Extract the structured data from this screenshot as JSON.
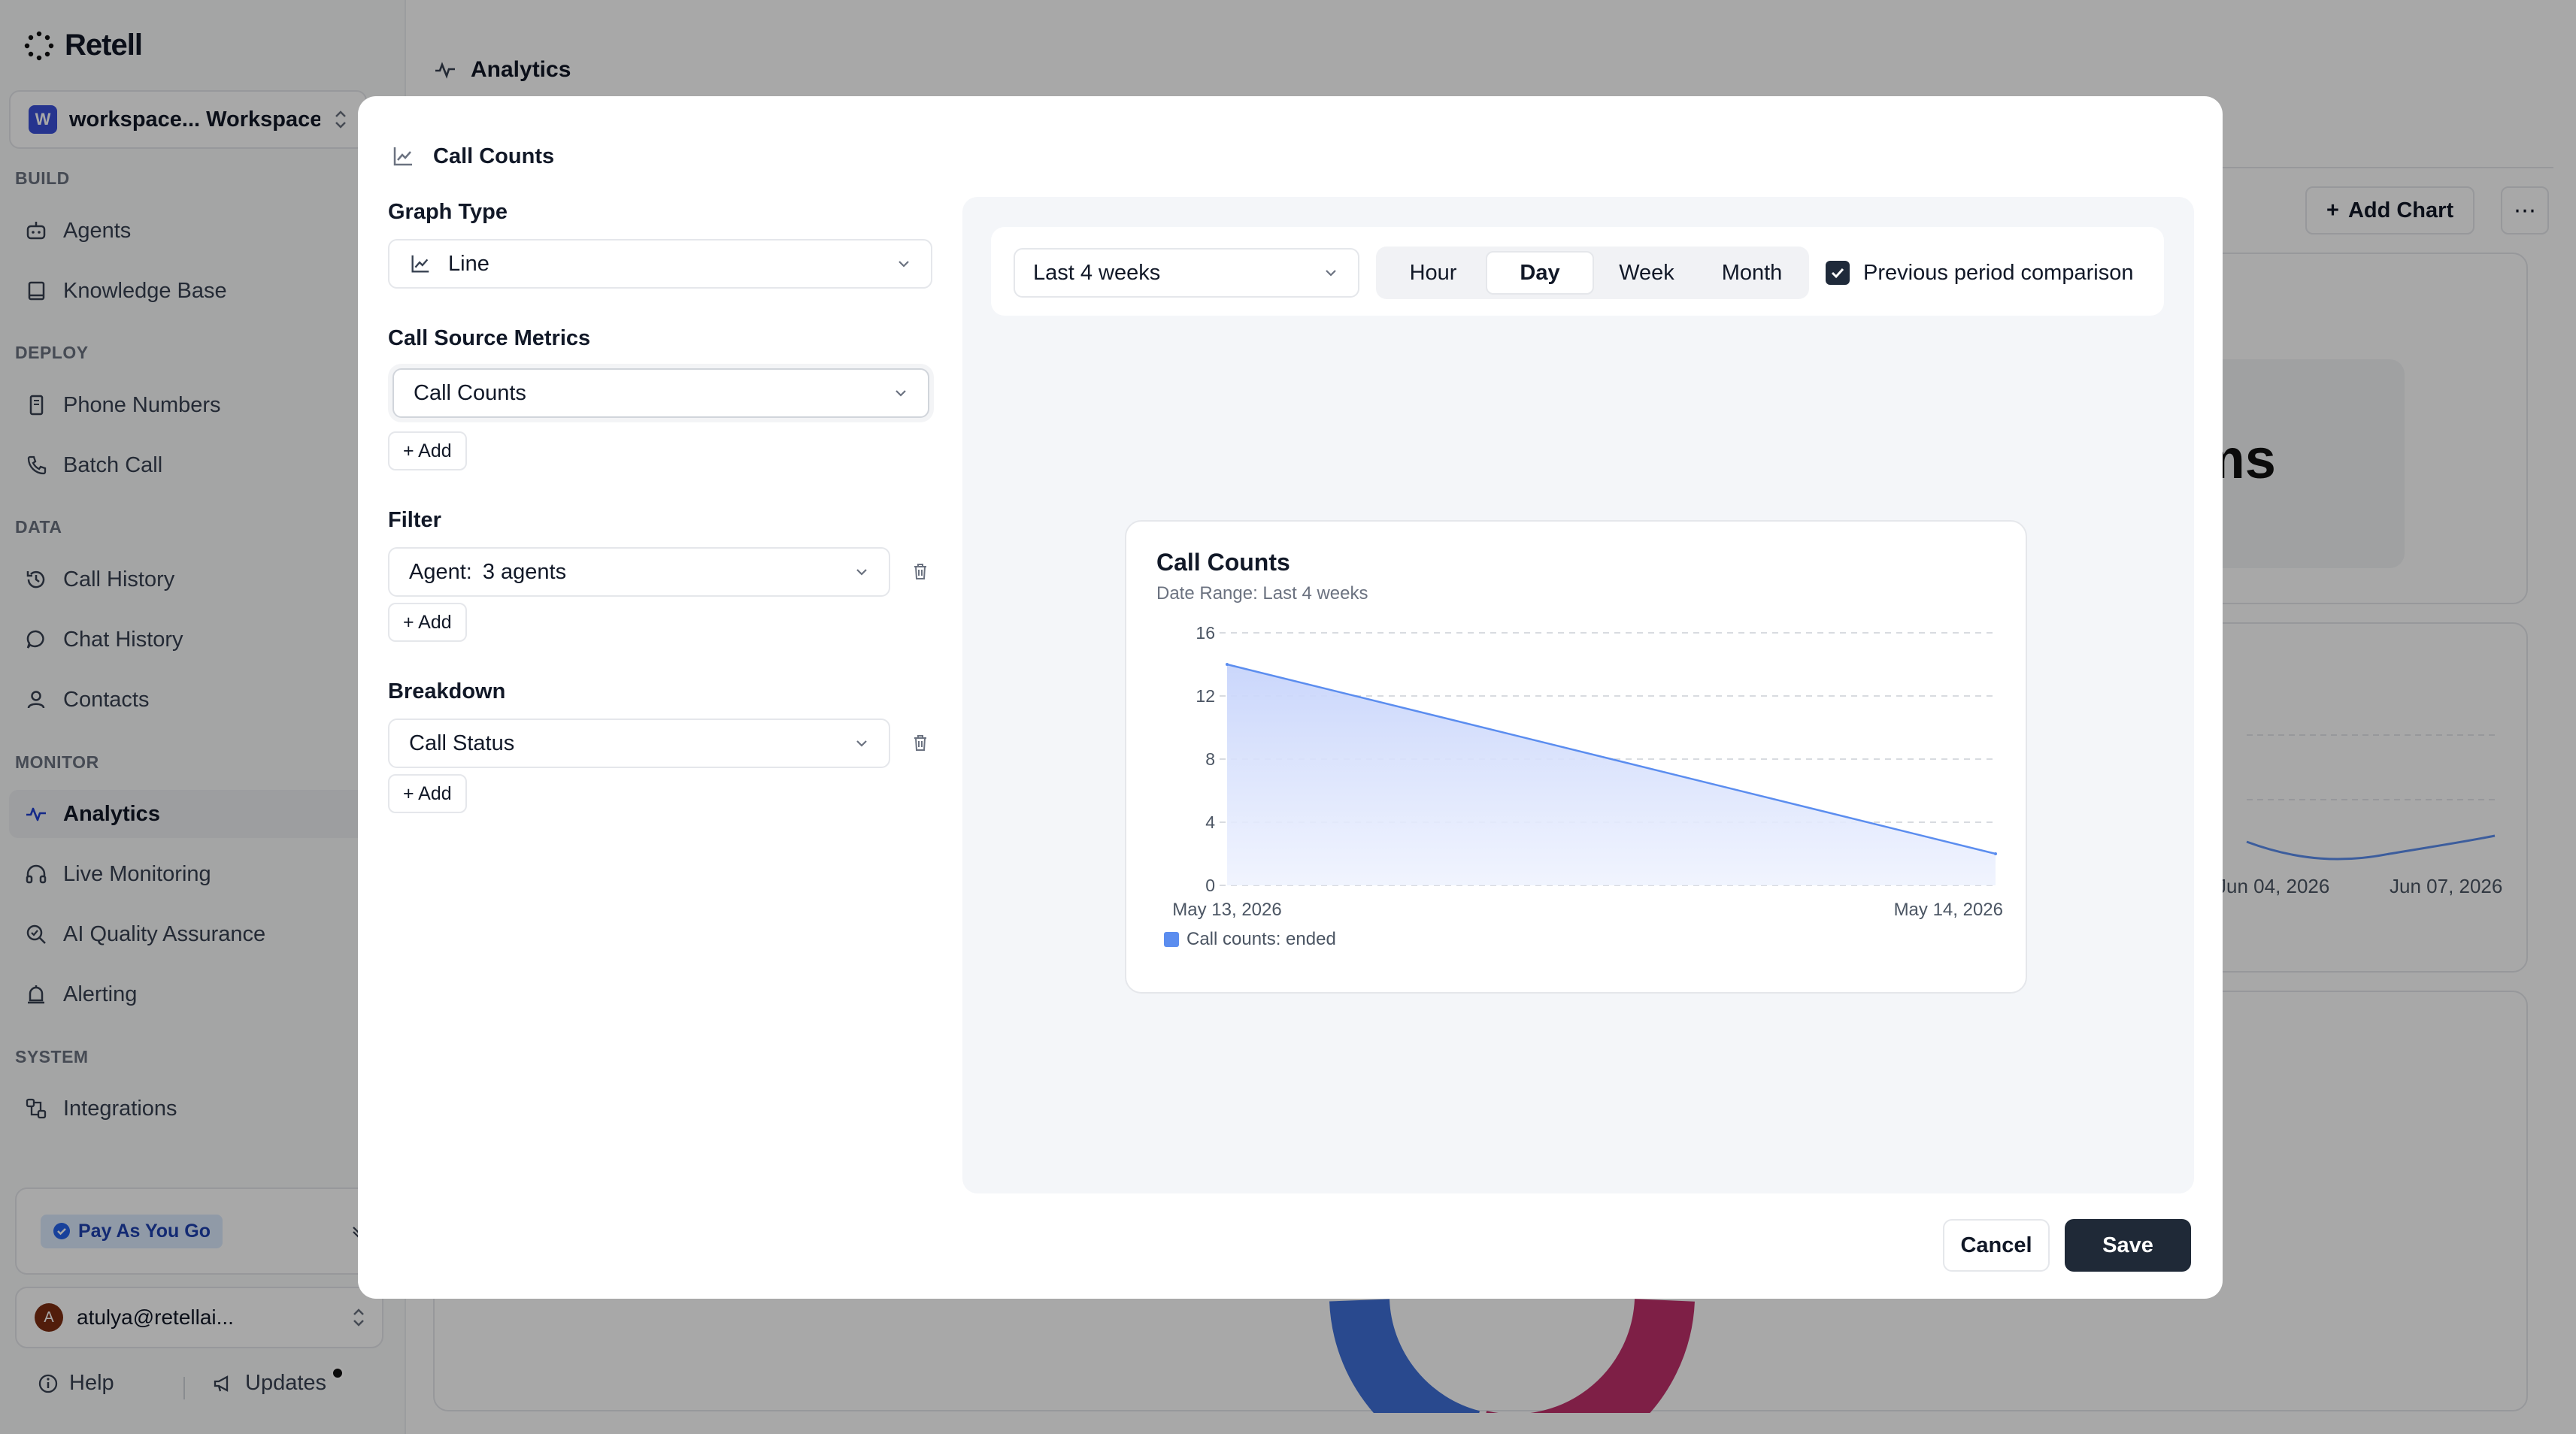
{
  "app": {
    "name": "Retell"
  },
  "workspace": {
    "initial": "W",
    "name": "workspace... Workspace"
  },
  "sidebar": {
    "sections": [
      {
        "label": "BUILD"
      },
      {
        "label": "DEPLOY"
      },
      {
        "label": "DATA"
      },
      {
        "label": "MONITOR"
      },
      {
        "label": "SYSTEM"
      }
    ],
    "items": [
      {
        "label": "Agents",
        "icon": "robot-icon"
      },
      {
        "label": "Knowledge Base",
        "icon": "book-icon"
      },
      {
        "label": "Phone Numbers",
        "icon": "phone-list-icon"
      },
      {
        "label": "Batch Call",
        "icon": "phone-icon"
      },
      {
        "label": "Call History",
        "icon": "history-icon"
      },
      {
        "label": "Chat History",
        "icon": "chat-icon"
      },
      {
        "label": "Contacts",
        "icon": "user-icon"
      },
      {
        "label": "Analytics",
        "icon": "pulse-icon",
        "active": true
      },
      {
        "label": "Live Monitoring",
        "icon": "headphones-icon"
      },
      {
        "label": "AI Quality Assurance",
        "icon": "search-check-icon"
      },
      {
        "label": "Alerting",
        "icon": "bell-icon"
      },
      {
        "label": "Integrations",
        "icon": "integrations-icon"
      }
    ],
    "plan": "Pay As You Go",
    "user": {
      "initial": "A",
      "email": "atulya@retellai..."
    },
    "footer": {
      "help": "Help",
      "updates": "Updates"
    }
  },
  "main": {
    "title": "Analytics",
    "add_chart": "Add Chart",
    "more": "⋯",
    "bg_text": "ms",
    "bg_ticks": [
      "Jun 04, 2026",
      "Jun 07, 2026"
    ]
  },
  "modal": {
    "title": "Call Counts",
    "graph_type_label": "Graph Type",
    "graph_type_value": "Line",
    "metrics_label": "Call Source Metrics",
    "metrics_value": "Call Counts",
    "add_label": "+ Add",
    "filter_label": "Filter",
    "filter_key": "Agent:",
    "filter_value": "3 agents",
    "breakdown_label": "Breakdown",
    "breakdown_value": "Call Status",
    "cancel": "Cancel",
    "save": "Save"
  },
  "toolbar": {
    "range": "Last 4 weeks",
    "granularity": [
      "Hour",
      "Day",
      "Week",
      "Month"
    ],
    "granularity_selected": "Day",
    "comparison_label": "Previous period comparison",
    "comparison_checked": true
  },
  "chart_data": {
    "type": "area",
    "title": "Call Counts",
    "subtitle": "Date Range: Last 4 weeks",
    "x": [
      "May 13, 2026",
      "May 14, 2026"
    ],
    "series": [
      {
        "name": "Call counts: ended",
        "values": [
          14,
          2
        ],
        "color": "#5b8def"
      }
    ],
    "ylim": [
      0,
      16
    ],
    "yticks": [
      0,
      4,
      8,
      12,
      16
    ],
    "grid": true,
    "legend": "bottom-left"
  }
}
